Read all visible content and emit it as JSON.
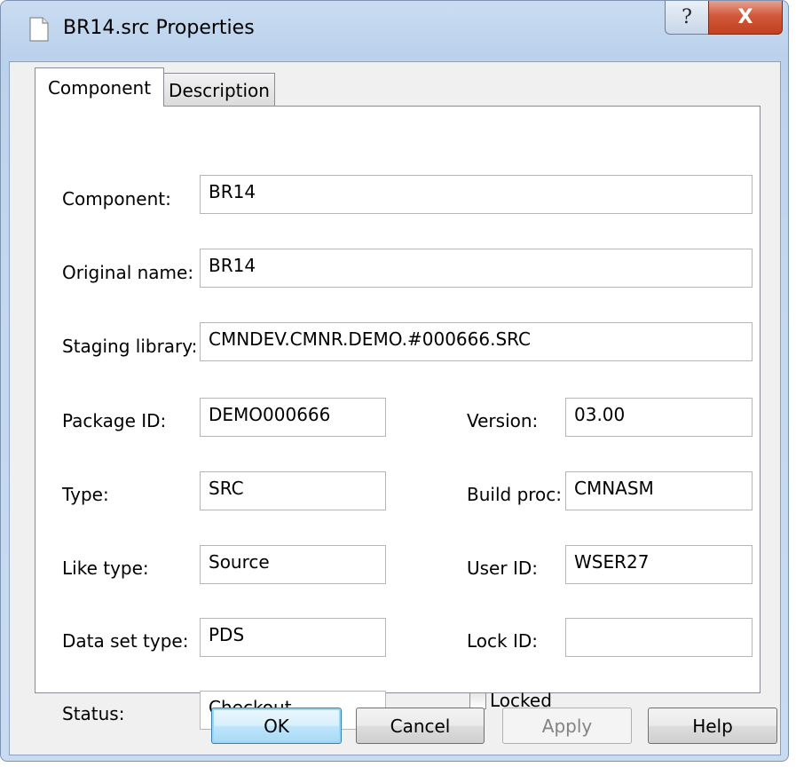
{
  "window": {
    "title": "BR14.src Properties",
    "help_glyph": "?",
    "close_glyph": "X",
    "icon": "document-icon"
  },
  "tabs": [
    {
      "label": "Component",
      "active": true
    },
    {
      "label": "Description",
      "active": false
    }
  ],
  "fields": {
    "component": {
      "label": "Component:",
      "value": "BR14"
    },
    "original_name": {
      "label": "Original name:",
      "value": "BR14"
    },
    "staging_library": {
      "label": "Staging library:",
      "value": "CMNDEV.CMNR.DEMO.#000666.SRC"
    },
    "package_id": {
      "label": "Package ID:",
      "value": "DEMO000666"
    },
    "version": {
      "label": "Version:",
      "value": "03.00"
    },
    "type": {
      "label": "Type:",
      "value": "SRC"
    },
    "build_proc": {
      "label": "Build proc:",
      "value": "CMNASM"
    },
    "like_type": {
      "label": "Like type:",
      "value": "Source"
    },
    "user_id": {
      "label": "User ID:",
      "value": "WSER27"
    },
    "data_set_type": {
      "label": "Data set type:",
      "value": "PDS"
    },
    "lock_id": {
      "label": "Lock ID:",
      "value": ""
    },
    "status": {
      "label": "Status:",
      "value": "Checkout"
    }
  },
  "locked": {
    "label": "Locked",
    "checked": false
  },
  "buttons": {
    "ok": "OK",
    "cancel": "Cancel",
    "apply": "Apply",
    "help": "Help"
  },
  "colors": {
    "frame": "#c3d7ef",
    "close_button": "#c3401f",
    "default_button_border": "#3c7fb1"
  }
}
